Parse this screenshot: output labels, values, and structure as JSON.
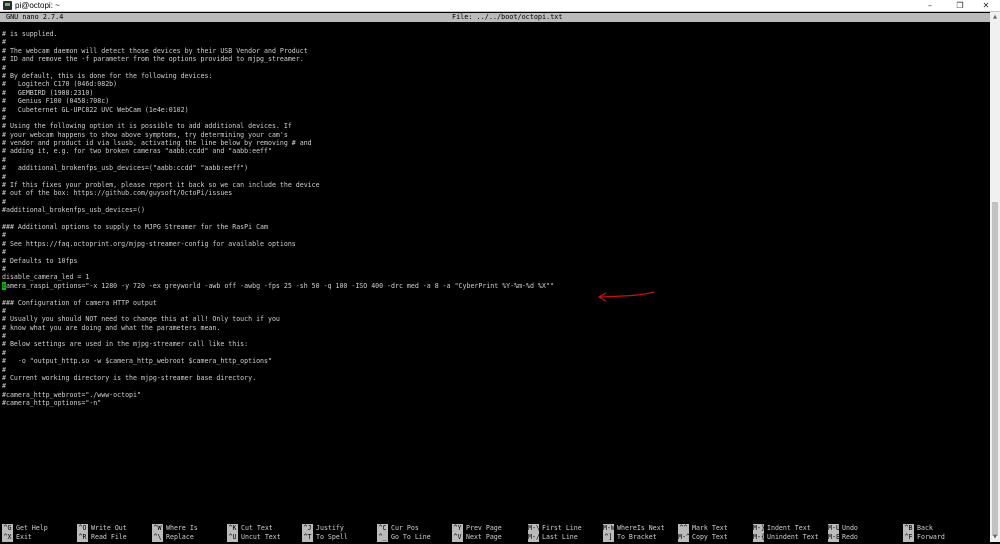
{
  "window": {
    "title": "pi@octopi: ~",
    "buttons": {
      "minimize": "–",
      "maximize": "❐",
      "close": "✕"
    }
  },
  "nano": {
    "version": "GNU nano 2.7.4",
    "file": "File: ../../boot/octopi.txt"
  },
  "editor_lines": [
    "# is supplied.",
    "#",
    "# The webcam daemon will detect those devices by their USB Vendor and Product",
    "# ID and remove the -f parameter from the options provided to mjpg_streamer.",
    "#",
    "# By default, this is done for the following devices:",
    "#   Logitech C170 (046d:082b)",
    "#   GEMBIRD (1908:2310)",
    "#   Genius F100 (0458:708c)",
    "#   Cubeternet GL-UPC822 UVC WebCam (1e4e:0102)",
    "#",
    "# Using the following option it is possible to add additional devices. If",
    "# your webcam happens to show above symptoms, try determining your cam's",
    "# vendor and product id via lsusb, activating the line below by removing # and",
    "# adding it, e.g. for two broken cameras \"aabb:ccdd\" and \"aabb:eeff\"",
    "#",
    "#   additional_brokenfps_usb_devices=(\"aabb:ccdd\" \"aabb:eeff\")",
    "#",
    "# If this fixes your problem, please report it back so we can include the device",
    "# out of the box: https://github.com/guysoft/OctoPi/issues",
    "#",
    "#additional_brokenfps_usb_devices=()",
    "",
    "### Additional options to supply to MJPG Streamer for the RasPi Cam",
    "#",
    "# See https://faq.octoprint.org/mjpg-streamer-config for available options",
    "#",
    "# Defaults to 10fps",
    "#",
    "disable_camera_led = 1",
    "camera_raspi_options=\"-x 1280 -y 720 -ex greyworld -awb off -awbg -fps 25 -sh 50 -q 100 -ISO 400 -drc med -a 8 -a \"CyberPrint %Y-%m-%d %X\"\"",
    "",
    "### Configuration of camera HTTP output",
    "#",
    "# Usually you should NOT need to change this at all! Only touch if you",
    "# know what you are doing and what the parameters mean.",
    "#",
    "# Below settings are used in the mjpg-streamer call like this:",
    "#",
    "#   -o \"output_http.so -w $camera_http_webroot $camera_http_options\"",
    "#",
    "# Current working directory is the mjpg-streamer base directory.",
    "#",
    "#camera_http_webroot=\"./www-octopi\"",
    "#camera_http_options=\"-n\""
  ],
  "shortcuts_row1": [
    {
      "key": "^G",
      "label": "Get Help"
    },
    {
      "key": "^O",
      "label": "Write Out"
    },
    {
      "key": "^W",
      "label": "Where Is"
    },
    {
      "key": "^K",
      "label": "Cut Text"
    },
    {
      "key": "^J",
      "label": "Justify"
    },
    {
      "key": "^C",
      "label": "Cur Pos"
    },
    {
      "key": "^Y",
      "label": "Prev Page"
    },
    {
      "key": "M-\\",
      "label": "First Line"
    },
    {
      "key": "M-W",
      "label": "WhereIs Next"
    },
    {
      "key": "^^",
      "label": "Mark Text"
    },
    {
      "key": "M-}",
      "label": "Indent Text"
    },
    {
      "key": "M-U",
      "label": "Undo"
    },
    {
      "key": "^B",
      "label": "Back"
    }
  ],
  "shortcuts_row2": [
    {
      "key": "^X",
      "label": "Exit"
    },
    {
      "key": "^R",
      "label": "Read File"
    },
    {
      "key": "^\\",
      "label": "Replace"
    },
    {
      "key": "^U",
      "label": "Uncut Text"
    },
    {
      "key": "^T",
      "label": "To Spell"
    },
    {
      "key": "^_",
      "label": "Go To Line"
    },
    {
      "key": "^V",
      "label": "Next Page"
    },
    {
      "key": "M-/",
      "label": "Last Line"
    },
    {
      "key": "^]",
      "label": "To Bracket"
    },
    {
      "key": "M-^",
      "label": "Copy Text"
    },
    {
      "key": "M-{",
      "label": "Unindent Text"
    },
    {
      "key": "M-E",
      "label": "Redo"
    },
    {
      "key": "^F",
      "label": "Forward"
    }
  ],
  "colors": {
    "annotation_arrow": "#cc1111",
    "cursor": "#00c000"
  }
}
